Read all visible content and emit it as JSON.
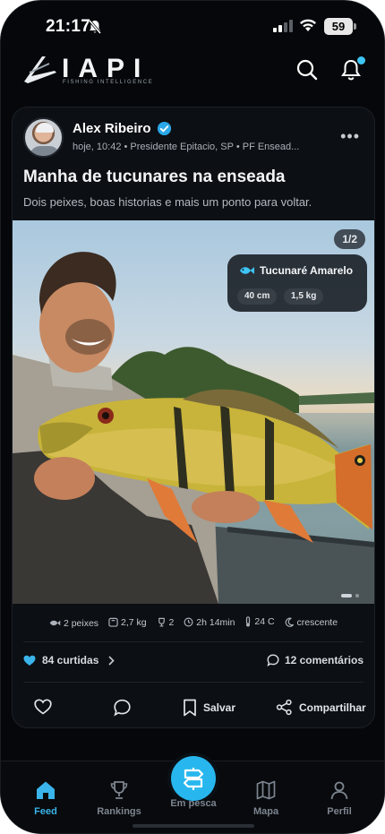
{
  "status_bar": {
    "time": "21:17",
    "battery": "59"
  },
  "brand": {
    "name": "IAPI",
    "tagline": "FISHING INTELLIGENCE"
  },
  "post": {
    "author": "Alex Ribeiro",
    "meta": "hoje, 10:42 • Presidente Epitacio, SP • PF Ensead...",
    "more": "•••",
    "title": "Manha de tucunares na enseada",
    "description": "Dois peixes, boas historias e mais um ponto para voltar.",
    "photo": {
      "counter": "1/2",
      "species": "Tucunaré Amarelo",
      "length": "40 cm",
      "weight": "1,5 kg"
    },
    "stats": {
      "fish": "2 peixes",
      "total_weight": "2,7 kg",
      "trophies": "2",
      "duration": "2h 14min",
      "temperature": "24 C",
      "moon": "crescente"
    },
    "likes": "84 curtidas",
    "comments": "12 comentários",
    "actions": {
      "save": "Salvar",
      "share": "Compartilhar"
    }
  },
  "tabbar": {
    "feed": "Feed",
    "rankings": "Rankings",
    "fishing": "Em pesca",
    "map": "Mapa",
    "profile": "Perfil"
  },
  "colors": {
    "accent": "#27b7ee",
    "background": "#05070a",
    "card": "#0c0f13",
    "like": "#3ab4ea"
  }
}
